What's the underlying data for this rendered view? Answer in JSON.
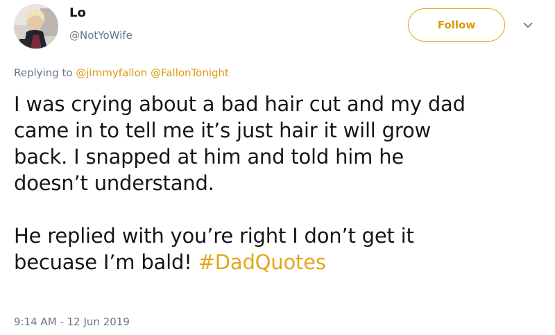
{
  "user": {
    "display_name": "Lo",
    "handle": "@NotYoWife"
  },
  "actions": {
    "follow_label": "Follow",
    "caret_icon": "chevron-down-icon"
  },
  "reply": {
    "prefix": "Replying to",
    "mentions": [
      "@jimmyfallon",
      "@FallonTonight"
    ]
  },
  "tweet": {
    "line1": "I was crying about a bad hair cut and my dad",
    "line2": "came in to tell me it’s just hair it will grow",
    "line3": "back. I snapped at him and told him he",
    "line4": "doesn’t understand.",
    "line5": "He replied with you’re right I don’t get it",
    "line6_text": "becuase I’m bald!",
    "hashtag": "#DadQuotes"
  },
  "meta": {
    "time": "9:14 AM",
    "separator": "-",
    "date": "12 Jun 2019"
  },
  "colors": {
    "accent": "#e3a61a",
    "text": "#14171a",
    "secondary_text": "#657786"
  }
}
